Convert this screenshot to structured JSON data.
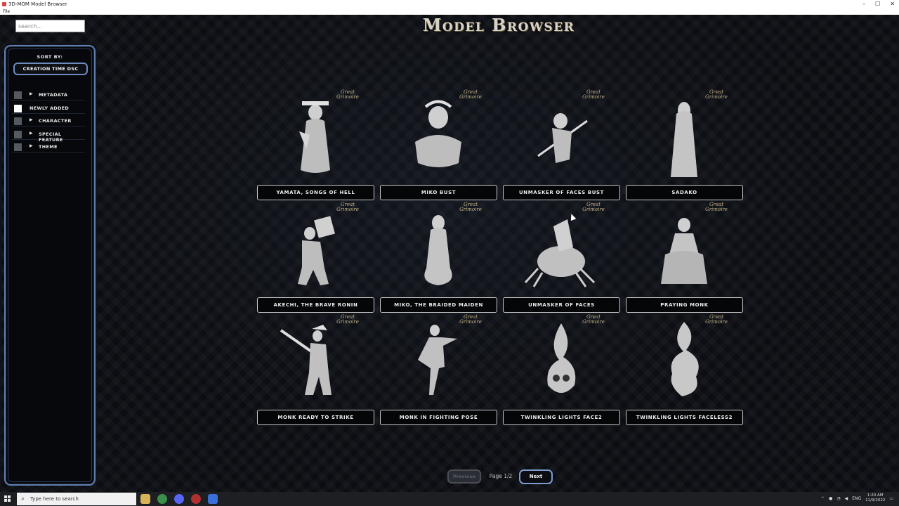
{
  "window": {
    "title": "3D-MOM Model Browser",
    "minimize": "–",
    "maximize": "☐",
    "close": "✕"
  },
  "menu": {
    "file": "File"
  },
  "search": {
    "placeholder": "search..."
  },
  "page_title": "Model Browser",
  "sidebar": {
    "sort_label": "SORT BY:",
    "sort_value": "CREATION TIME DSC",
    "filters": [
      {
        "label": "METADATA",
        "checked": false,
        "expandable": true
      },
      {
        "label": "NEWLY ADDED",
        "checked": true,
        "expandable": false
      },
      {
        "label": "CHARACTER",
        "checked": false,
        "expandable": true
      },
      {
        "label": "SPECIAL FEATURE",
        "checked": false,
        "expandable": true
      },
      {
        "label": "THEME",
        "checked": false,
        "expandable": true
      }
    ]
  },
  "brand": {
    "line1": "Great",
    "line2": "Grimoire"
  },
  "models": [
    {
      "label": "YAMATA, SONGS OF HELL",
      "icon": "geisha-figure"
    },
    {
      "label": "MIKO BUST",
      "icon": "bust-figure"
    },
    {
      "label": "UNMASKER OF FACES BUST",
      "icon": "spear-figure"
    },
    {
      "label": "SADAKO",
      "icon": "ghost-girl-figure"
    },
    {
      "label": "AKECHI, THE BRAVE RONIN",
      "icon": "ronin-figure"
    },
    {
      "label": "MIKO, THE BRAIDED MAIDEN",
      "icon": "maiden-figure"
    },
    {
      "label": "UNMASKER OF FACES",
      "icon": "spider-figure"
    },
    {
      "label": "PRAYING MONK",
      "icon": "monk-figure"
    },
    {
      "label": "MONK READY TO STRIKE",
      "icon": "monk-staff-figure"
    },
    {
      "label": "MONK IN FIGHTING POSE",
      "icon": "monk-kick-figure"
    },
    {
      "label": "TWINKLING LIGHTS FACE2",
      "icon": "skull-flame-figure"
    },
    {
      "label": "TWINKLING LIGHTS FACELESS2",
      "icon": "flame-figure"
    }
  ],
  "pager": {
    "previous": "Previous",
    "page": "Page 1/2",
    "next": "Next"
  },
  "taskbar": {
    "search_placeholder": "Type here to search",
    "language": "ENG",
    "time": "1:20 AM",
    "date": "11/9/2022"
  },
  "colors": {
    "accent": "#6c8cc0",
    "background": "#0b0d12",
    "brand": "#c8b58a"
  }
}
